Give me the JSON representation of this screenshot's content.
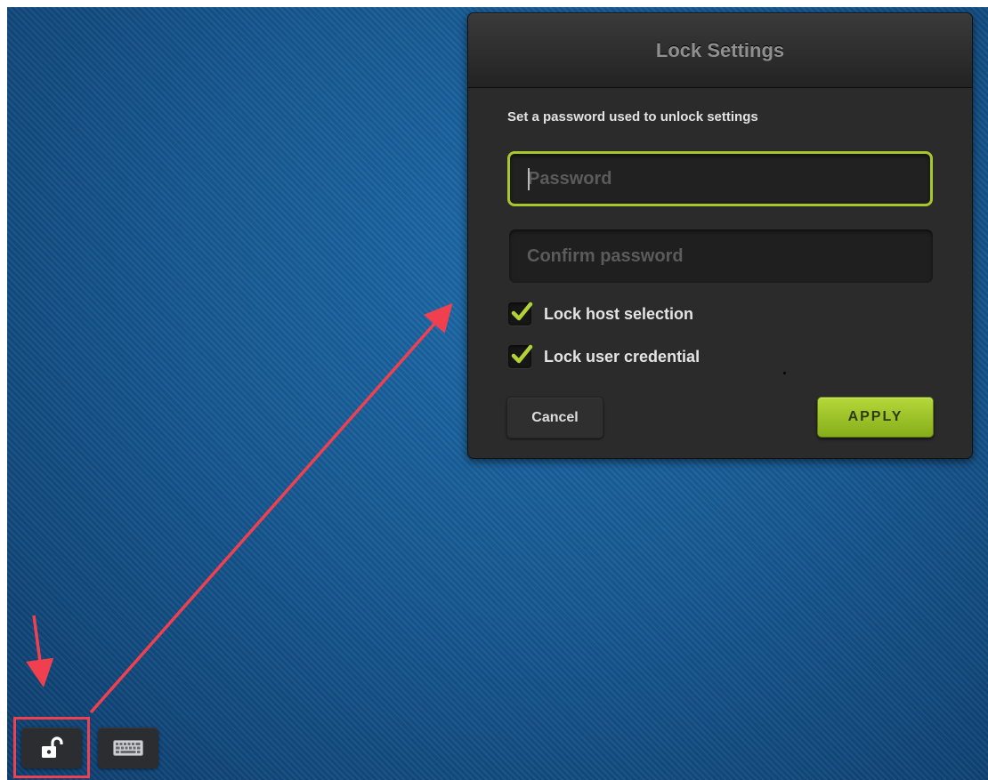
{
  "dialog": {
    "title": "Lock Settings",
    "instructions": "Set a password used to unlock settings",
    "password_placeholder": "Password",
    "confirm_placeholder": "Confirm password",
    "options": [
      {
        "label": "Lock host selection",
        "checked": true
      },
      {
        "label": "Lock user credential",
        "checked": true
      }
    ],
    "cancel_label": "Cancel",
    "apply_label": "APPLY"
  },
  "toolbar": {
    "lock_icon": "unlock-icon",
    "keyboard_icon": "keyboard-icon"
  },
  "colors": {
    "accent_green": "#a8c82a",
    "dialog_bg": "#2b2b2b",
    "desktop_blue": "#175a94",
    "annotation_red": "#f0404f"
  }
}
